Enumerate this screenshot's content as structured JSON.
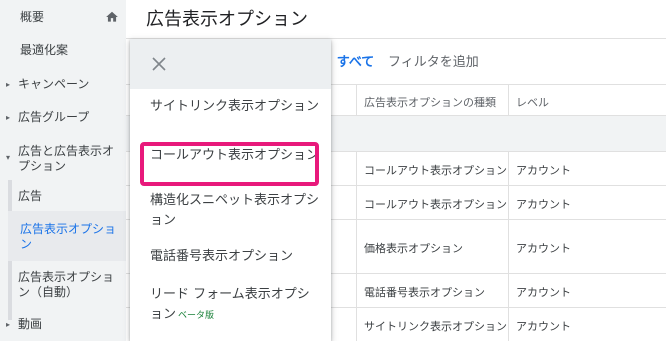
{
  "sidebar": {
    "overview": "概要",
    "recommendations": "最適化案",
    "campaigns": "キャンペーン",
    "ad_groups": "広告グループ",
    "ads_and_extensions": "広告と広告表示オプション",
    "ads": "広告",
    "extensions_active": "広告表示オプション",
    "extensions_auto": "広告表示オプション（自動）",
    "videos": "動画"
  },
  "main": {
    "title": "広告表示オプション",
    "filter_label": "類: すべて",
    "filter_add": "フィルタを追加",
    "columns": {
      "type": "広告表示オプションの種類",
      "level": "レベル"
    },
    "rows": [
      {
        "type": "コールアウト表示オプション",
        "level": "アカウント"
      },
      {
        "type": "コールアウト表示オプション",
        "level": "アカウント"
      },
      {
        "type": "価格表示オプション",
        "level": "アカウント"
      },
      {
        "type": "電話番号表示オプション",
        "level": "アカウント"
      },
      {
        "type": "サイトリンク表示オプション",
        "level": "アカウント"
      }
    ]
  },
  "menu": {
    "items": [
      "サイトリンク表示オプション",
      "コールアウト表示オプション",
      "構造化スニペット表示オプション",
      "電話番号表示オプション",
      "リード フォーム表示オプション"
    ],
    "beta": "ベータ版"
  },
  "colors": {
    "accent": "#1a73e8",
    "highlight": "#e8197b",
    "beta": "#188038"
  }
}
